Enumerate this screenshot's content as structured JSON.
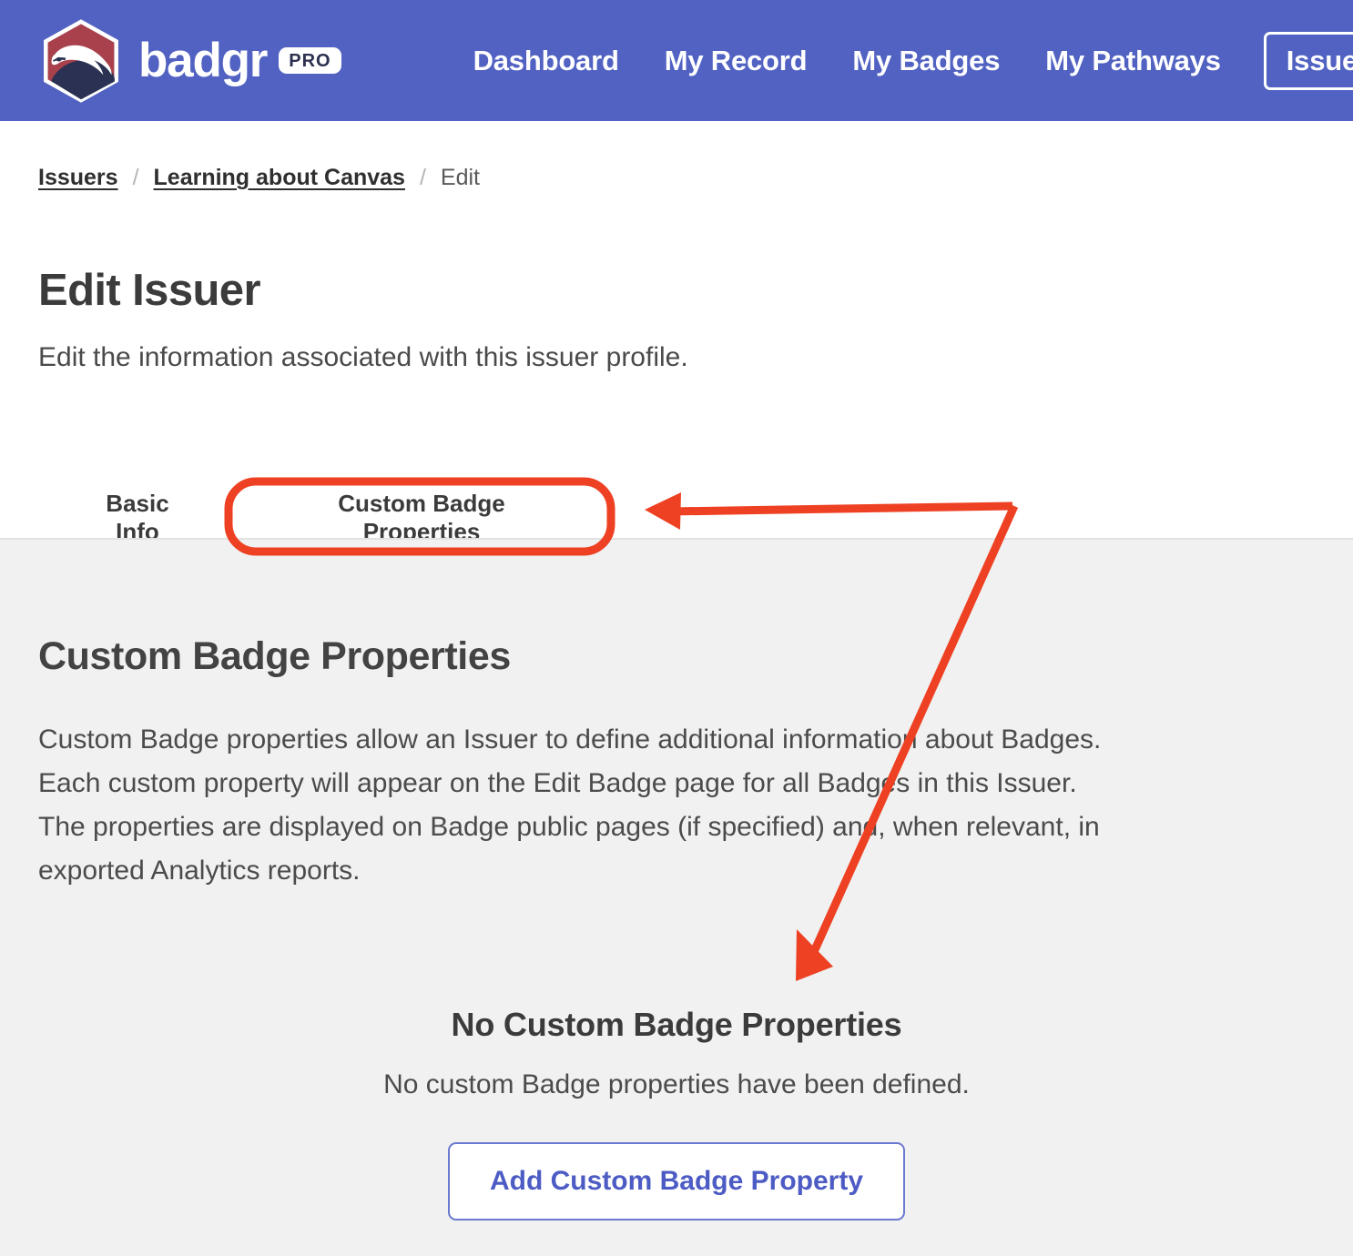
{
  "header": {
    "brand_name": "badgr",
    "brand_badge": "PRO",
    "logo_icon": "badger-hexagon-logo-icon",
    "nav": [
      {
        "label": "Dashboard",
        "name": "nav-dashboard"
      },
      {
        "label": "My Record",
        "name": "nav-my-record"
      },
      {
        "label": "My Badges",
        "name": "nav-my-badges"
      },
      {
        "label": "My Pathways",
        "name": "nav-my-pathways"
      },
      {
        "label": "Issuers",
        "name": "nav-issuers"
      }
    ],
    "colors": {
      "background": "#5162c2",
      "text": "#ffffff"
    }
  },
  "breadcrumb": {
    "items": [
      {
        "label": "Issuers",
        "type": "link"
      },
      {
        "label": "Learning about Canvas",
        "type": "link"
      },
      {
        "label": "Edit",
        "type": "current"
      }
    ],
    "separator": "/"
  },
  "page": {
    "title": "Edit Issuer",
    "subtitle": "Edit the information associated with this issuer profile."
  },
  "tabs": {
    "items": [
      {
        "label": "Basic Info",
        "active": false
      },
      {
        "label": "Custom Badge Properties",
        "active": true
      }
    ]
  },
  "section": {
    "title": "Custom Badge Properties",
    "description": "Custom Badge properties allow an Issuer to define additional information about Badges. Each custom property will appear on the Edit Badge page for all Badges in this Issuer. The properties are displayed on Badge public pages (if specified) and, when relevant, in exported Analytics reports."
  },
  "empty_state": {
    "title": "No Custom Badge Properties",
    "message": "No custom Badge properties have been defined.",
    "button_label": "Add Custom Badge Property"
  },
  "annotations": {
    "highlight_color": "#ee4123",
    "shapes": [
      {
        "kind": "rounded-rect-highlight",
        "target": "Custom Badge Properties tab"
      },
      {
        "kind": "arrow-left",
        "target": "Custom Badge Properties tab"
      },
      {
        "kind": "arrow-down",
        "target": "No Custom Badge Properties empty state"
      }
    ]
  },
  "colors": {
    "header_blue": "#5162c2",
    "panel_gray": "#f1f1f1",
    "annotation_red": "#ee4123",
    "button_blue": "#4d5cc4",
    "logo_maroon": "#a8414c",
    "logo_navy": "#2b3152"
  }
}
